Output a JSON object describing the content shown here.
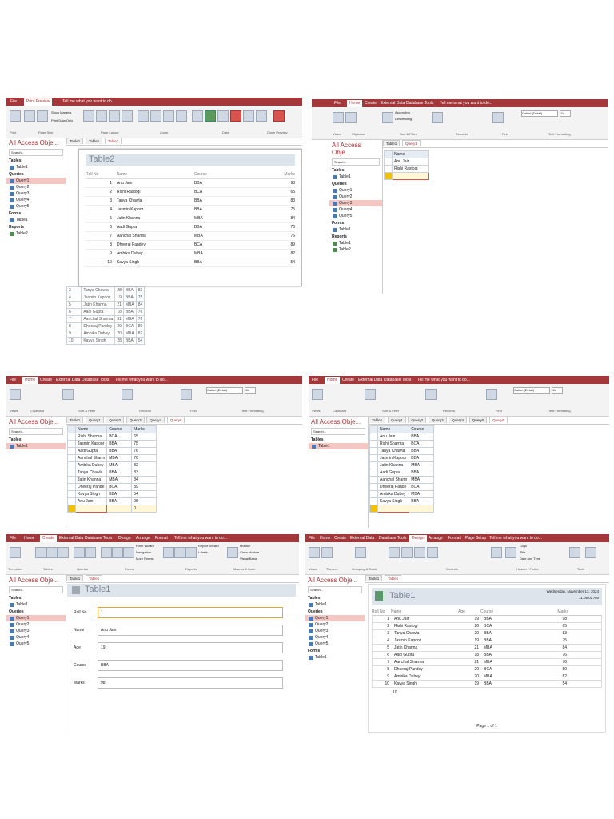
{
  "shot1": {
    "tabs": [
      "File",
      "Print Preview"
    ],
    "tell_me": "Tell me what you want to do...",
    "ribbon_groups": [
      "Print",
      "Page Size",
      "Page Layout",
      "Zoom",
      "Data",
      "Close Preview"
    ],
    "ribbon_buttons": [
      "Print",
      "Size",
      "Margins",
      "Portrait",
      "Landscape",
      "Columns",
      "Page Setup",
      "Zoom",
      "One Page",
      "Two Pages",
      "More Pages",
      "Refresh All",
      "Excel",
      "Text File",
      "PDF or XPS",
      "Email",
      "More",
      "Close Print Preview"
    ],
    "margin_options": [
      "Show Margins",
      "Print Data Only"
    ],
    "nav_title": "All Access Obje...",
    "search": "Search...",
    "nav": {
      "tables_header": "Tables",
      "tables": [
        "Table1"
      ],
      "queries_header": "Queries",
      "queries": [
        "Query1",
        "Query2",
        "Query3",
        "Query4",
        "Query5"
      ],
      "forms_header": "Forms",
      "forms": [
        "Table1"
      ],
      "reports_header": "Reports",
      "reports": [
        "Table2"
      ]
    },
    "doc_tabs": [
      "Table1",
      "Table1",
      "Table2"
    ],
    "report_title": "Table2",
    "columns": [
      "Roll No",
      "Name",
      "Course",
      "Marks"
    ],
    "rows": [
      [
        "1",
        "Anu Jain",
        "BBA",
        "98"
      ],
      [
        "2",
        "Rishi Rastogi",
        "BCA",
        "65"
      ],
      [
        "3",
        "Tanya Chawla",
        "BBA",
        "83"
      ],
      [
        "4",
        "Jasmin Kapoor",
        "BBA",
        "75"
      ],
      [
        "5",
        "Jatin Khanna",
        "MBA",
        "84"
      ],
      [
        "6",
        "Aadi Gupta",
        "BBA",
        "76"
      ],
      [
        "7",
        "Aanchal Sharma",
        "MBA",
        "76"
      ],
      [
        "8",
        "Dheeraj Pandey",
        "BCA",
        "89"
      ],
      [
        "9",
        "Ambika Dubey",
        "MBA",
        "82"
      ],
      [
        "10",
        "Kavya Singh",
        "BBA",
        "54"
      ]
    ],
    "under_rows": [
      [
        "3",
        "Tanya Chawla",
        "28",
        "BBA",
        "83"
      ],
      [
        "4",
        "Jasmin Kapoor",
        "19",
        "BBA",
        "75"
      ],
      [
        "5",
        "Jatin Khanna",
        "21",
        "MBA",
        "84"
      ],
      [
        "6",
        "Aadi Gupta",
        "18",
        "BBA",
        "76"
      ],
      [
        "7",
        "Aanchal Sharma",
        "31",
        "MBA",
        "76"
      ],
      [
        "8",
        "Dheeraj Pandey",
        "29",
        "BCA",
        "89"
      ],
      [
        "9",
        "Ambika Dubey",
        "20",
        "MBA",
        "82"
      ],
      [
        "10",
        "Kavya Singh",
        "28",
        "BBA",
        "54"
      ]
    ],
    "under_new": [
      "(New)",
      "0"
    ]
  },
  "shot2": {
    "tabs": [
      "File",
      "Home",
      "Create",
      "External Data",
      "Database Tools"
    ],
    "tell_me": "Tell me what you want to do...",
    "ribbon_groups": [
      "Views",
      "Clipboard",
      "Sort & Filter",
      "Records",
      "Find",
      "Text Formatting"
    ],
    "ribbon_buttons": [
      "View",
      "Paste",
      "Cut",
      "Copy",
      "Format Painter",
      "Filter",
      "Ascending",
      "Descending",
      "Remove Sort",
      "Selection",
      "Advanced",
      "Toggle Filter",
      "Refresh All",
      "New",
      "Save",
      "Delete",
      "Totals",
      "Spelling",
      "More",
      "Find",
      "Replace",
      "Go To",
      "Select"
    ],
    "font": "Calibri (Detail)",
    "font_size": "11",
    "nav_title": "All Access Obje...",
    "search": "Search...",
    "nav": {
      "tables_header": "Tables",
      "tables": [
        "Table1"
      ],
      "queries_header": "Queries",
      "queries": [
        "Query1",
        "Query2",
        "Query3",
        "Query4",
        "Query5"
      ],
      "forms_header": "Forms",
      "forms": [
        "Table1"
      ],
      "reports_header": "Reports",
      "reports": [
        "Table1",
        "Table2"
      ]
    },
    "doc_tabs": [
      "Table1",
      "Query1"
    ],
    "columns": [
      "Name"
    ],
    "rows": [
      [
        "Anu Jain"
      ],
      [
        "Rishi Rastogi"
      ]
    ]
  },
  "shot3": {
    "tabs": [
      "File",
      "Home",
      "Create",
      "External Data",
      "Database Tools"
    ],
    "tell_me": "Tell me what you want to do...",
    "ribbon_groups": [
      "Views",
      "Clipboard",
      "Sort & Filter",
      "Records",
      "Find",
      "Text Formatting"
    ],
    "font": "Calibri (Detail)",
    "font_size": "11",
    "nav_title": "All Access Obje...",
    "search": "Search...",
    "nav": {
      "tables_header": "Tables",
      "tables": [
        "Table1"
      ]
    },
    "doc_tabs": [
      "Table1",
      "Query1",
      "Query2",
      "Query3",
      "Query4",
      "Query5"
    ],
    "columns": [
      "Name",
      "Course",
      "Marks"
    ],
    "rows": [
      [
        "Rishi Sharma",
        "BCA",
        "65"
      ],
      [
        "Jasmin Kapoor",
        "BBA",
        "75"
      ],
      [
        "Aadi Gupta",
        "BBA",
        "76"
      ],
      [
        "Aanchal Sharm",
        "MBA",
        "76"
      ],
      [
        "Ambika Dubey",
        "MBA",
        "82"
      ],
      [
        "Tanya Chawla",
        "BBA",
        "83"
      ],
      [
        "Jatin Khanna",
        "MBA",
        "84"
      ],
      [
        "Dheeraj Pande",
        "BCA",
        "89"
      ],
      [
        "Kavya Singh",
        "BBA",
        "54"
      ],
      [
        "Anu Jain",
        "BBA",
        "98"
      ]
    ],
    "new_value": "0"
  },
  "shot4": {
    "tabs": [
      "File",
      "Home",
      "Create",
      "External Data",
      "Database Tools"
    ],
    "tell_me": "Tell me what you want to do...",
    "ribbon_groups": [
      "Views",
      "Clipboard",
      "Sort & Filter",
      "Records",
      "Find",
      "Text Formatting"
    ],
    "font": "Calibri (Detail)",
    "font_size": "11",
    "nav_title": "All Access Obje...",
    "search": "Search...",
    "nav": {
      "tables_header": "Tables",
      "tables": [
        "Table1"
      ]
    },
    "doc_tabs": [
      "Table1",
      "Query1",
      "Query2",
      "Query3",
      "Query4",
      "Query5",
      "Query6"
    ],
    "columns": [
      "Name",
      "Course"
    ],
    "rows": [
      [
        "Anu Jain",
        "BBA"
      ],
      [
        "Rishi Sharma",
        "BCA"
      ],
      [
        "Tanya Chawla",
        "BBA"
      ],
      [
        "Jasmin Kapoor",
        "BBA"
      ],
      [
        "Jatin Khanna",
        "MBA"
      ],
      [
        "Aadi Gupta",
        "BBA"
      ],
      [
        "Aanchal Sharm",
        "MBA"
      ],
      [
        "Dheeraj Pande",
        "BCA"
      ],
      [
        "Ambika Dubey",
        "MBA"
      ],
      [
        "Kavya Singh",
        "BBA"
      ]
    ]
  },
  "shot5": {
    "tabs": [
      "File",
      "Home",
      "Create",
      "External Data",
      "Database Tools",
      "Design",
      "Arrange",
      "Format"
    ],
    "tell_me": "Tell me what you want to do...",
    "ribbon_groups": [
      "Templates",
      "Tables",
      "Queries",
      "Forms",
      "Reports",
      "Macros & Code"
    ],
    "ribbon_buttons": [
      "Application Parts",
      "Table",
      "Table Design",
      "SharePoint Lists",
      "Query Wizard",
      "Query Design",
      "Form",
      "Form Design",
      "Blank Form",
      "Form Wizard",
      "Navigation",
      "More Forms",
      "Report",
      "Report Design",
      "Blank Report",
      "Report Wizard",
      "Labels",
      "Macro",
      "Module",
      "Class Module",
      "Visual Basic"
    ],
    "nav_title": "All Access Obje...",
    "search": "Search...",
    "nav": {
      "tables_header": "Tables",
      "tables": [
        "Table1"
      ],
      "queries_header": "Queries",
      "queries": [
        "Query1",
        "Query2",
        "Query3",
        "Query4",
        "Query5"
      ]
    },
    "doc_tabs": [
      "Table1",
      "Table1"
    ],
    "form_title": "Table1",
    "fields": [
      {
        "label": "Roll No",
        "value": "1"
      },
      {
        "label": "Name",
        "value": "Anu Jain"
      },
      {
        "label": "Age",
        "value": "19"
      },
      {
        "label": "Course",
        "value": "BBA"
      },
      {
        "label": "Marks",
        "value": "98"
      }
    ]
  },
  "shot6": {
    "tabs": [
      "File",
      "Home",
      "Create",
      "External Data",
      "Database Tools",
      "Design",
      "Arrange",
      "Format",
      "Page Setup"
    ],
    "tell_me": "Tell me what you want to do...",
    "ribbon_groups": [
      "Views",
      "Themes",
      "Grouping & Totals",
      "Controls",
      "Header / Footer",
      "Tools"
    ],
    "ribbon_buttons": [
      "View",
      "Themes",
      "Colors",
      "Fonts",
      "Group & Sort",
      "Totals",
      "Hide Details",
      "Insert Image",
      "Page Numbers",
      "Logo",
      "Title",
      "Date and Time",
      "Add Existing Fields",
      "Property Sheet"
    ],
    "nav_title": "All Access Obje...",
    "search": "Search...",
    "nav": {
      "tables_header": "Tables",
      "tables": [
        "Table1"
      ],
      "queries_header": "Queries",
      "queries": [
        "Query1",
        "Query2",
        "Query3",
        "Query4",
        "Query5"
      ],
      "forms_header": "Forms",
      "forms": [
        "Table1"
      ]
    },
    "doc_tabs": [
      "Table1",
      "Table1"
    ],
    "report_title": "Table1",
    "date": "Wednesday, November 13, 2024",
    "time": "11:05:02 AM",
    "columns": [
      "Roll No",
      "Name",
      "Age",
      "Course",
      "Marks"
    ],
    "rows": [
      [
        "1",
        "Anu Jain",
        "19",
        "BBA",
        "98"
      ],
      [
        "2",
        "Rishi Rastogi",
        "20",
        "BCA",
        "65"
      ],
      [
        "3",
        "Tanya Chawla",
        "20",
        "BBA",
        "83"
      ],
      [
        "4",
        "Jasmin Kapoor",
        "19",
        "BBA",
        "75"
      ],
      [
        "5",
        "Jatin Khanna",
        "21",
        "MBA",
        "84"
      ],
      [
        "6",
        "Aadi Gupta",
        "18",
        "BBA",
        "76"
      ],
      [
        "7",
        "Aanchal Sharma",
        "21",
        "MBA",
        "76"
      ],
      [
        "8",
        "Dheeraj Pandey",
        "20",
        "BCA",
        "89"
      ],
      [
        "9",
        "Ambika Dubey",
        "20",
        "MBA",
        "82"
      ],
      [
        "10",
        "Kavya Singh",
        "19",
        "BBA",
        "54"
      ]
    ],
    "record_count": "10",
    "page_footer": "Page 1 of 1"
  }
}
